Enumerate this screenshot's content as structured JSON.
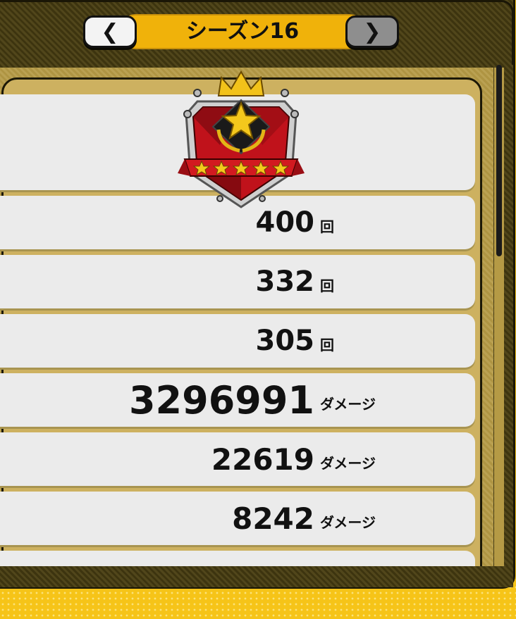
{
  "header": {
    "title": "シーズン16",
    "prev_label": "❮",
    "next_label": "❯"
  },
  "rank_emblem": {
    "icon": "rank-emblem-icon",
    "stars": 5
  },
  "stats": [
    {
      "value": "400",
      "unit": "回"
    },
    {
      "value": "332",
      "unit": "回"
    },
    {
      "value": "305",
      "unit": "回"
    },
    {
      "value": "3296991",
      "unit": "ダメージ"
    },
    {
      "value": "22619",
      "unit": "ダメージ"
    },
    {
      "value": "8242",
      "unit": "ダメージ"
    }
  ],
  "colors": {
    "title_pill": "#f0b20a",
    "frame": "#4a3f12",
    "row_bg": "#ebebeb",
    "next_button": "#8e8e8e"
  }
}
